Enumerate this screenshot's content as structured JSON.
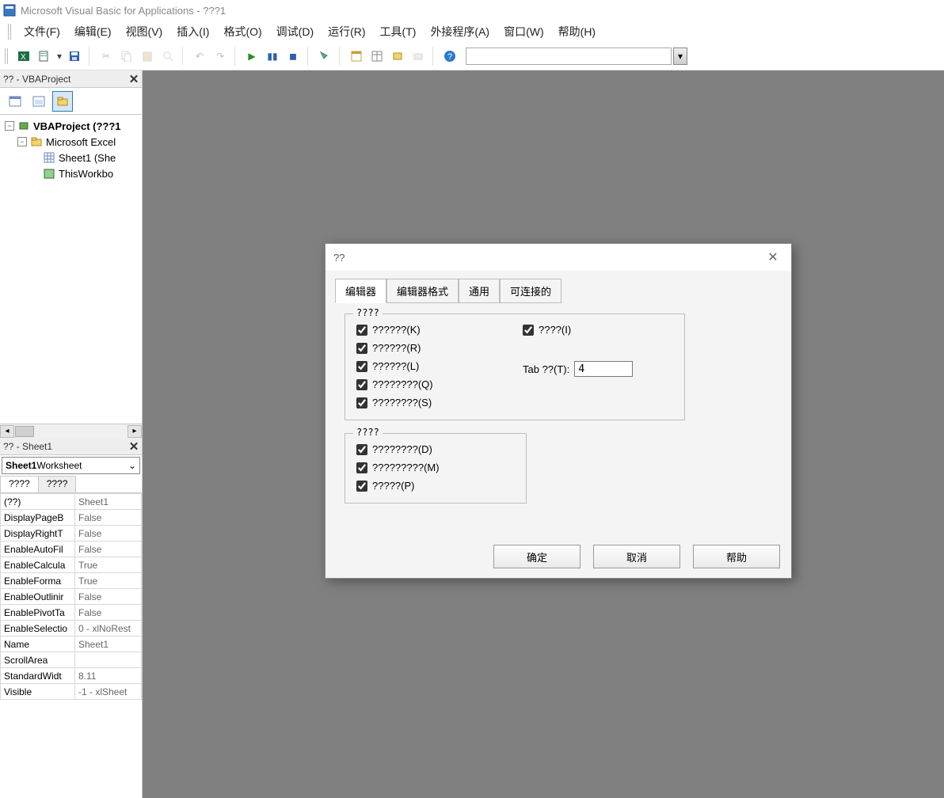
{
  "title": "Microsoft Visual Basic for Applications - ???1",
  "menu": [
    "文件(F)",
    "编辑(E)",
    "视图(V)",
    "插入(I)",
    "格式(O)",
    "调试(D)",
    "运行(R)",
    "工具(T)",
    "外接程序(A)",
    "窗口(W)",
    "帮助(H)"
  ],
  "project_pane": {
    "title": "?? - VBAProject",
    "nodes": {
      "root": "VBAProject (???1",
      "excel": "Microsoft Excel",
      "sheet": "Sheet1 (She",
      "twb": "ThisWorkbo"
    }
  },
  "props_pane": {
    "title": "?? - Sheet1",
    "object_combo": {
      "bold": "Sheet1",
      "rest": " Worksheet"
    },
    "tabs": [
      "????",
      "????"
    ],
    "rows": [
      [
        "(??)",
        "Sheet1"
      ],
      [
        "DisplayPageB",
        "False"
      ],
      [
        "DisplayRightT",
        "False"
      ],
      [
        "EnableAutoFil",
        "False"
      ],
      [
        "EnableCalcula",
        "True"
      ],
      [
        "EnableForma",
        "True"
      ],
      [
        "EnableOutlinir",
        "False"
      ],
      [
        "EnablePivotTa",
        "False"
      ],
      [
        "EnableSelectio",
        "0 - xlNoRest"
      ],
      [
        "Name",
        "Sheet1"
      ],
      [
        "ScrollArea",
        ""
      ],
      [
        "StandardWidt",
        "8.11"
      ],
      [
        "Visible",
        "-1 - xlSheet"
      ]
    ]
  },
  "dialog": {
    "title": "??",
    "tabs": [
      "编辑器",
      "编辑器格式",
      "通用",
      "可连接的"
    ],
    "group1": {
      "legend": "????",
      "left": [
        "??????(K)",
        "??????(R)",
        "??????(L)",
        "????????(Q)",
        "????????(S)"
      ],
      "right_ck": "????(I)",
      "tab_label": "Tab ??(T):",
      "tab_value": "4"
    },
    "group2": {
      "legend": "????",
      "items": [
        "????????(D)",
        "?????????(M)",
        "?????(P)"
      ]
    },
    "buttons": {
      "ok": "确定",
      "cancel": "取消",
      "help": "帮助"
    }
  }
}
